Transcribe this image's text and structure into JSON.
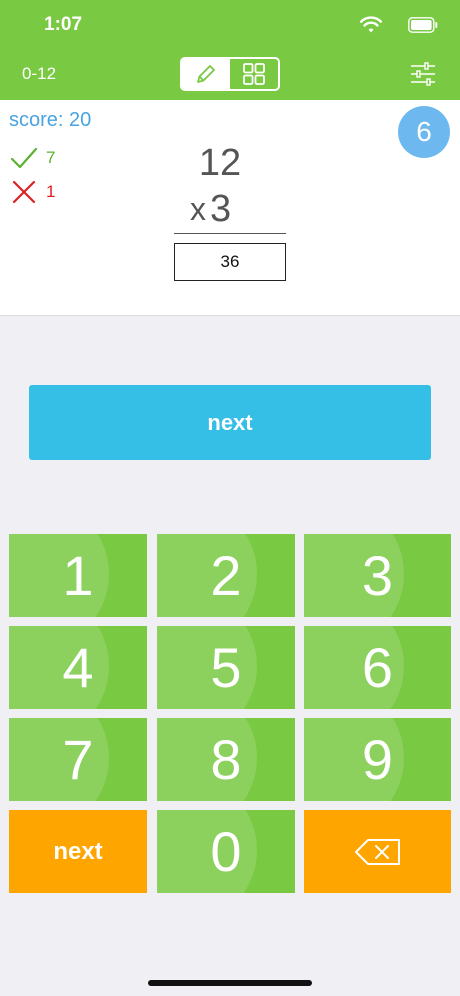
{
  "status_bar": {
    "time": "1:07"
  },
  "header": {
    "range_label": "0-12",
    "mode_toggle": {
      "left_icon": "pencil-icon",
      "right_icon": "grid-icon",
      "active": "left"
    },
    "settings_icon": "sliders-icon"
  },
  "card": {
    "score_label": "score: 20",
    "correct_count": "7",
    "wrong_count": "1",
    "level_badge": "6",
    "operand_top": "12",
    "operator": "x",
    "operand_bottom": "3",
    "answer": "36"
  },
  "next_button": {
    "label": "next"
  },
  "keypad": {
    "keys": [
      "1",
      "2",
      "3",
      "4",
      "5",
      "6",
      "7",
      "8",
      "9"
    ],
    "next_label": "next",
    "zero": "0",
    "backspace_icon": "backspace-icon"
  },
  "colors": {
    "header_green": "#7ac943",
    "key_green": "#7ac943",
    "next_blue": "#36bfe6",
    "action_orange": "#ffa500",
    "score_blue": "#4aa3df",
    "badge_blue": "#6eb8f0"
  }
}
